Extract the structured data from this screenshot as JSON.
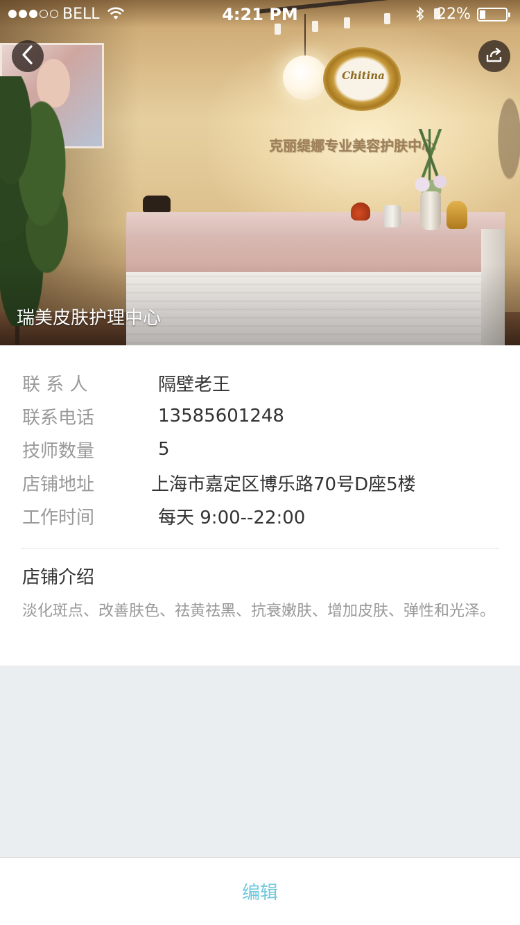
{
  "status_bar": {
    "carrier": "BELL",
    "time": "4:21 PM",
    "battery_percent": "22%",
    "battery_level": 0.22,
    "signal_bars_filled": 3,
    "signal_bars_total": 5
  },
  "icons": {
    "back": "chevron-left-icon",
    "share": "share-icon",
    "wifi": "wifi-icon",
    "bluetooth": "bluetooth-icon"
  },
  "hero": {
    "title": "瑞美皮肤护理中心",
    "wall_sign": "克丽缇娜专业美容护肤中心",
    "logo_text": "Chitina"
  },
  "details": {
    "contact": {
      "label": "联 系 人",
      "value": "隔壁老王"
    },
    "phone": {
      "label": "联系电话",
      "value": "13585601248"
    },
    "technicians": {
      "label": "技师数量",
      "value": "5"
    },
    "address": {
      "label": "店铺地址",
      "value": "上海市嘉定区博乐路70号D座5楼"
    },
    "hours": {
      "label": "工作时间",
      "value": "每天 9:00--22:00"
    }
  },
  "intro": {
    "title": "店铺介绍",
    "text": "淡化斑点、改善肤色、祛黄祛黑、抗衰嫩肤、增加皮肤、弹性和光泽。"
  },
  "bottom": {
    "edit_label": "编辑"
  },
  "colors": {
    "accent": "#6ec8dc",
    "page_background": "#ebeef1",
    "label_gray": "#999999",
    "value_dark": "#333333"
  }
}
